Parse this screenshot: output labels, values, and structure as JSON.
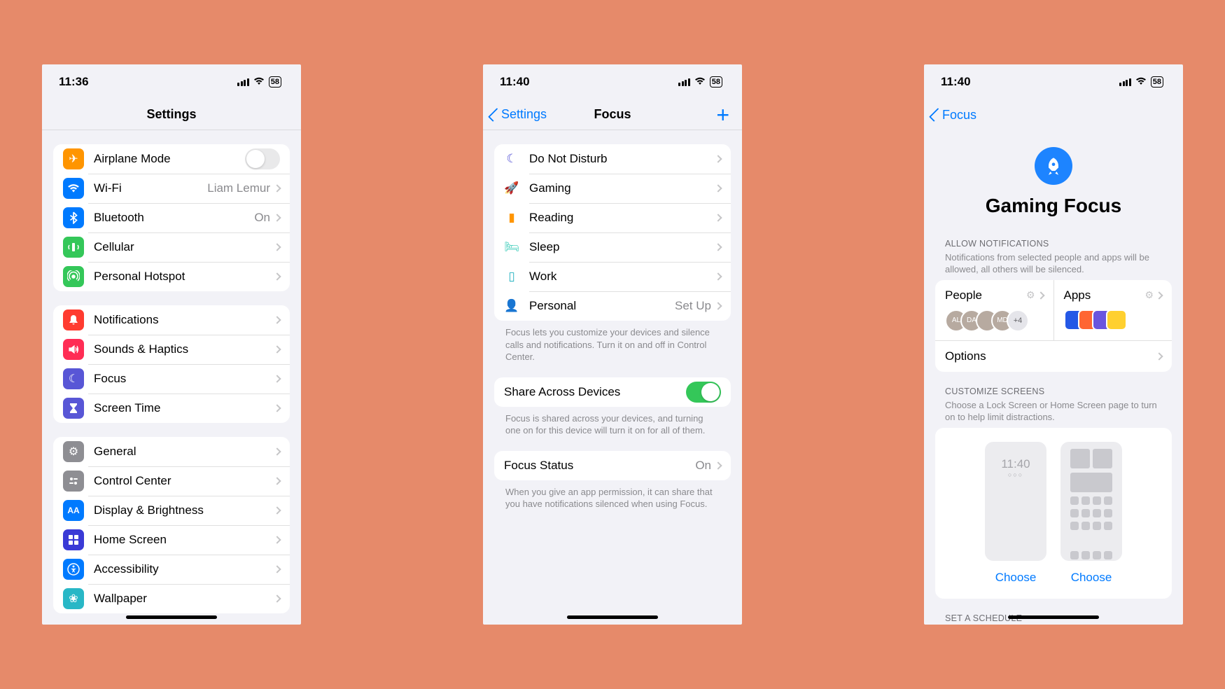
{
  "screen1": {
    "time": "11:36",
    "title": "Settings",
    "g1": [
      {
        "icon": "✈︎",
        "bg": "#ff9500",
        "label": "Airplane Mode",
        "toggle": "off"
      },
      {
        "icon": "",
        "bg": "#007aff",
        "label": "Wi-Fi",
        "value": "Liam Lemur",
        "svg": "wifi"
      },
      {
        "icon": "",
        "bg": "#007aff",
        "label": "Bluetooth",
        "value": "On",
        "svg": "bt"
      },
      {
        "icon": "",
        "bg": "#34c759",
        "label": "Cellular",
        "svg": "cell"
      },
      {
        "icon": "",
        "bg": "#34c759",
        "label": "Personal Hotspot",
        "svg": "hotspot"
      }
    ],
    "g2": [
      {
        "icon": "",
        "bg": "#ff3b30",
        "label": "Notifications",
        "svg": "bell"
      },
      {
        "icon": "",
        "bg": "#ff2d55",
        "label": "Sounds & Haptics",
        "svg": "sound"
      },
      {
        "icon": "☾",
        "bg": "#5856d6",
        "label": "Focus"
      },
      {
        "icon": "",
        "bg": "#5856d6",
        "label": "Screen Time",
        "svg": "hourglass"
      }
    ],
    "g3": [
      {
        "icon": "⚙",
        "bg": "#8e8e93",
        "label": "General"
      },
      {
        "icon": "",
        "bg": "#8e8e93",
        "label": "Control Center",
        "svg": "cc"
      },
      {
        "icon": "AA",
        "bg": "#007aff",
        "label": "Display & Brightness",
        "txt": true
      },
      {
        "icon": "",
        "bg": "#3a3ad6",
        "label": "Home Screen",
        "svg": "grid"
      },
      {
        "icon": "",
        "bg": "#007aff",
        "label": "Accessibility",
        "svg": "access"
      },
      {
        "icon": "❀",
        "bg": "#28b7c6",
        "label": "Wallpaper"
      }
    ]
  },
  "screen2": {
    "time": "11:40",
    "back": "Settings",
    "title": "Focus",
    "modes": [
      {
        "icon": "☾",
        "color": "#5856d6",
        "label": "Do Not Disturb"
      },
      {
        "icon": "🚀",
        "color": "#1d84ff",
        "label": "Gaming"
      },
      {
        "icon": "▮",
        "color": "#ff9500",
        "label": "Reading"
      },
      {
        "icon": "🛏",
        "color": "#2ec8b4",
        "label": "Sleep"
      },
      {
        "icon": "▯",
        "color": "#26b3c1",
        "label": "Work"
      },
      {
        "icon": "👤",
        "color": "#af52de",
        "label": "Personal",
        "value": "Set Up"
      }
    ],
    "modes_footer": "Focus lets you customize your devices and silence calls and notifications. Turn it on and off in Control Center.",
    "share_label": "Share Across Devices",
    "share_footer": "Focus is shared across your devices, and turning one on for this device will turn it on for all of them.",
    "status_label": "Focus Status",
    "status_value": "On",
    "status_footer": "When you give an app permission, it can share that you have notifications silenced when using Focus."
  },
  "screen3": {
    "time": "11:40",
    "back": "Focus",
    "title": "Gaming Focus",
    "allow_header": "ALLOW NOTIFICATIONS",
    "allow_desc": "Notifications from selected people and apps will be allowed, all others will be silenced.",
    "people_label": "People",
    "apps_label": "Apps",
    "people": [
      "AL",
      "DA",
      "",
      "MD"
    ],
    "people_more": "+4",
    "app_colors": [
      "#2458e6",
      "#ff6633",
      "#6a55df",
      "#ffd02f"
    ],
    "options_label": "Options",
    "customize_header": "CUSTOMIZE SCREENS",
    "customize_desc": "Choose a Lock Screen or Home Screen page to turn on to help limit distractions.",
    "thumb_time": "11:40",
    "choose": "Choose",
    "schedule_header": "SET A SCHEDULE"
  }
}
